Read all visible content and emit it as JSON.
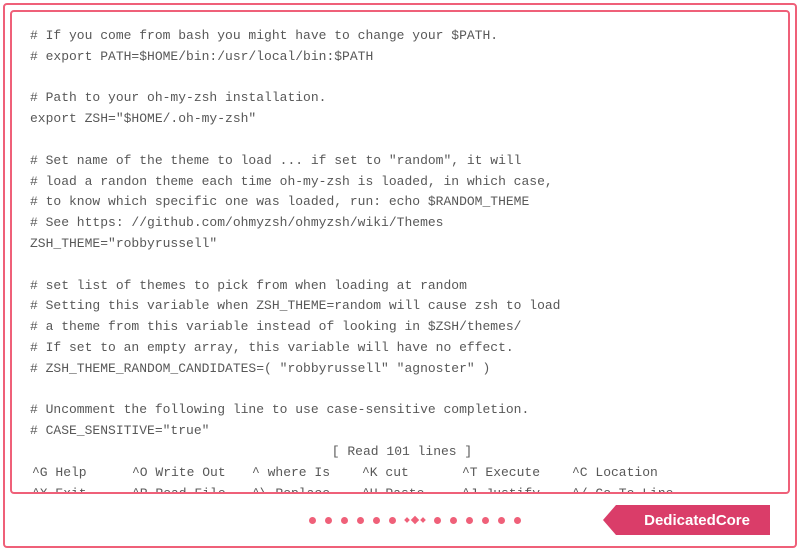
{
  "file_lines": [
    "# If you come from bash you might have to change your $PATH.",
    "# export PATH=$HOME/bin:/usr/local/bin:$PATH",
    "",
    "# Path to your oh-my-zsh installation.",
    "export ZSH=\"$HOME/.oh-my-zsh\"",
    "",
    "# Set name of the theme to load ... if set to \"random\", it will",
    "# load a randon theme each time oh-my-zsh is loaded, in which case,",
    "# to know which specific one was loaded, run: echo $RANDOM_THEME",
    "# See https: //github.com/ohmyzsh/ohmyzsh/wiki/Themes",
    "ZSH_THEME=\"robbyrussell\"",
    "",
    "# set list of themes to pick from when loading at random",
    "# Setting this variable when ZSH_THEME=random will cause zsh to load",
    "# a theme from this variable instead of looking in $ZSH/themes/",
    "# If set to an empty array, this variable will have no effect.",
    "# ZSH_THEME_RANDOM_CANDIDATES=( \"robbyrussell\" \"agnoster\" )",
    "",
    "# Uncomment the following line to use case-sensitive completion.",
    "# CASE_SENSITIVE=\"true\""
  ],
  "status": "[ Read 101 lines ]",
  "shortcuts": {
    "row1": [
      {
        "key": "^G",
        "label": "Help"
      },
      {
        "key": "^O",
        "label": "Write Out"
      },
      {
        "key": "^",
        "label": "where Is"
      },
      {
        "key": "^K",
        "label": "cut"
      },
      {
        "key": "^T",
        "label": "Execute"
      },
      {
        "key": "^C",
        "label": "Location"
      }
    ],
    "row2": [
      {
        "key": "^X",
        "label": "Exit"
      },
      {
        "key": "^R",
        "label": "Read File"
      },
      {
        "key": "^\\",
        "label": "Replace"
      },
      {
        "key": "^U",
        "label": "Paste"
      },
      {
        "key": "^J",
        "label": "Justify"
      },
      {
        "key": "^/",
        "label": "Go To Line"
      }
    ]
  },
  "brand": "DedicatedCore"
}
